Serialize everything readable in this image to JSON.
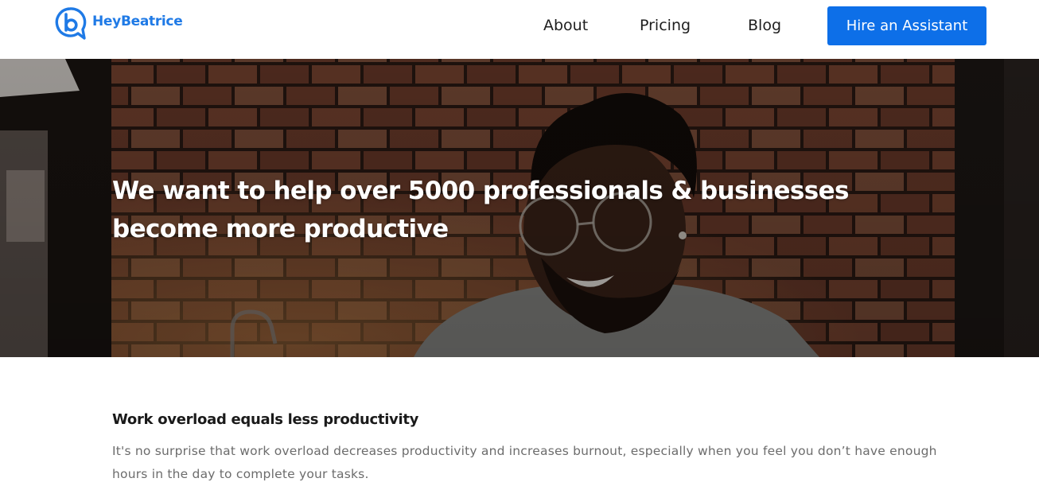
{
  "brand": {
    "name": "HeyBeatrice",
    "color": "#1f7ae6"
  },
  "nav": {
    "links": [
      "About",
      "Pricing",
      "Blog"
    ],
    "cta_label": "Hire an Assistant",
    "cta_color": "#0d6fe8"
  },
  "hero": {
    "headline": "We want to help over 5000 professionals & businesses become more productive"
  },
  "content": {
    "heading": "Work overload equals less productivity",
    "body": "It's no surprise that work overload decreases productivity and increases burnout, especially when you feel you don’t have enough hours in the day to complete your tasks."
  }
}
